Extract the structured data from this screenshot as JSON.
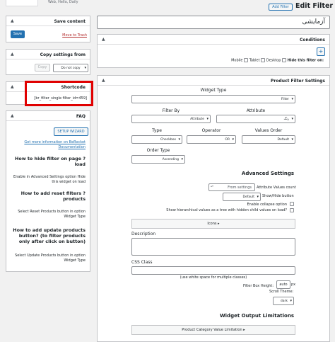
{
  "top": {
    "title": "Edit Filter",
    "add_filter": "Add Filter",
    "crumb_left": "Web, Hello, Daily",
    "name_value": "آزمایشی"
  },
  "sidebar": {
    "save": {
      "title": "Save content",
      "save_label": "Save",
      "trash_label": "Move to Trash"
    },
    "copy": {
      "title": "Copy settings from",
      "copy_label": "Copy",
      "dont_copy": "Do not copy"
    },
    "shortcode": {
      "title": "Shortcode",
      "value": "[br_filter_single filter_id=459]"
    },
    "faq": {
      "title": "FAQ",
      "wizard_label": "SETUP WIZARD",
      "doc_link": "Get more information on BeRocket Documentation",
      "items": [
        {
          "q": "How to hide filter on page ?load",
          "a": "Enable in Advanced Settings option Hide this widget on load"
        },
        {
          "q": "How to add reset filters ?products",
          "a": "Select Reset Products button in option Widget Type"
        },
        {
          "q": "How to add update products button? (to filter products only after click on button)",
          "a": "Select Update Products button in option Widget Type"
        }
      ]
    }
  },
  "conditions": {
    "title": "Conditions",
    "add": "+",
    "hide_label": "Hide this filter on:",
    "devices": [
      "Desktop",
      "Tablet",
      "Mobile"
    ]
  },
  "product_filter": {
    "title": "Product Filter Settings",
    "widget_type_label": "Widget Type",
    "widget_type_value": "Filter",
    "filter_by_label": "Filter By",
    "filter_by_value": "Attribute",
    "attribute_label": "Attribute",
    "attribute_value": "رنگ",
    "type_label": "Type",
    "type_value": "Checkbox",
    "operator_label": "Operator",
    "operator_value": "OR",
    "values_order_label": "Values Order",
    "values_order_value": "Default",
    "order_type_label": "Order Type",
    "order_type_value": "Ascending",
    "advanced_title": "Advanced Settings",
    "attr_count_label": "Attribute Values count",
    "attr_count_value": "From settings",
    "show_hide_label": "Show/Hide button",
    "show_hide_value": "Default",
    "collapse_label": "Enable collapse option",
    "hierarchical_label": "Show hierarchical values as a tree with hidden child values on load?",
    "icons_label": "Icons",
    "description_label": "Description",
    "css_label": "CSS Class",
    "css_hint": "(use white space for multiple classes)",
    "box_height_label": "Filter Box Height:",
    "box_height_value": "auto",
    "box_height_unit": "px",
    "scroll_theme_label": "Scroll Theme:",
    "scroll_theme_value": "dark",
    "limitations_title": "Widget Output Limitations",
    "limitation_value": "Product Category Value Limitation"
  },
  "colors": {
    "accent": "#2271b1",
    "highlight": "#e00000"
  }
}
